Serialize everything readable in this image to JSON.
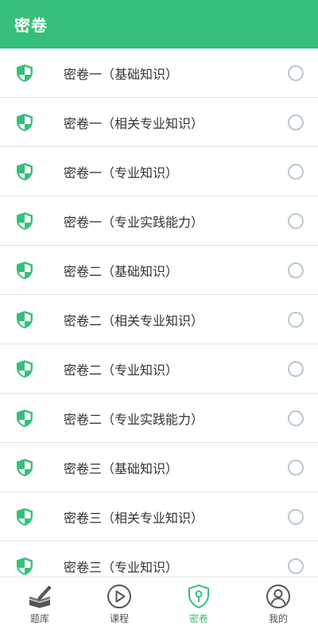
{
  "header": {
    "title": "密卷"
  },
  "items": [
    {
      "label": "密卷一（基础知识）"
    },
    {
      "label": "密卷一（相关专业知识）"
    },
    {
      "label": "密卷一（专业知识）"
    },
    {
      "label": "密卷一（专业实践能力）"
    },
    {
      "label": "密卷二（基础知识）"
    },
    {
      "label": "密卷二（相关专业知识）"
    },
    {
      "label": "密卷二（专业知识）"
    },
    {
      "label": "密卷二（专业实践能力）"
    },
    {
      "label": "密卷三（基础知识）"
    },
    {
      "label": "密卷三（相关专业知识）"
    },
    {
      "label": "密卷三（专业知识）"
    }
  ],
  "tabs": [
    {
      "label": "题库",
      "icon": "question-bank-icon",
      "active": false
    },
    {
      "label": "课程",
      "icon": "play-circle-icon",
      "active": false
    },
    {
      "label": "密卷",
      "icon": "secret-paper-icon",
      "active": true
    },
    {
      "label": "我的",
      "icon": "user-icon",
      "active": false
    }
  ],
  "colors": {
    "accent": "#35c07a",
    "radio": "#b9c8d0",
    "text": "#333333"
  }
}
